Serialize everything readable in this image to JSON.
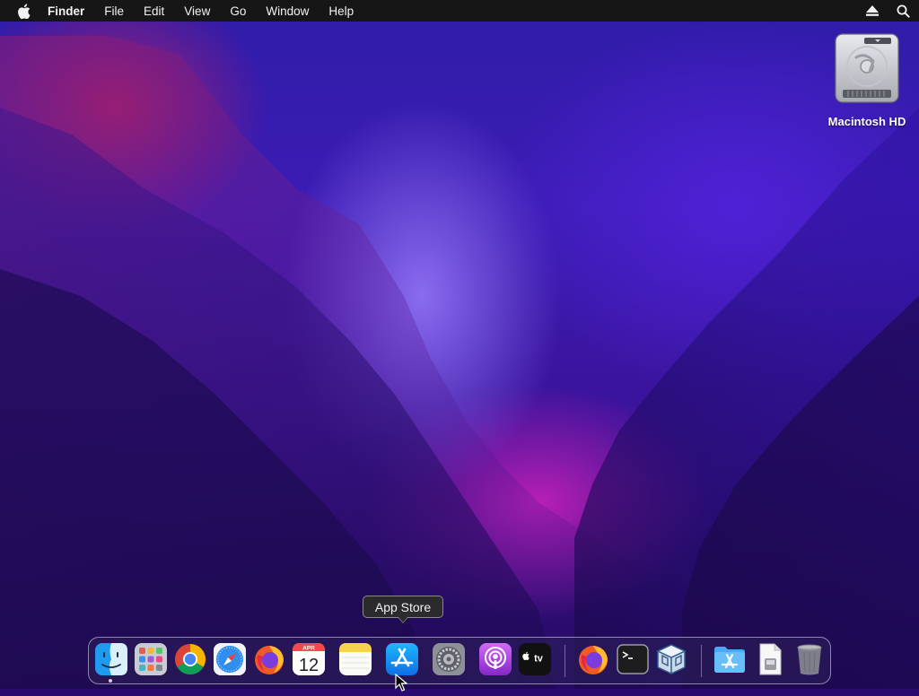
{
  "menubar": {
    "apple_menu": "apple-logo",
    "app_name": "Finder",
    "items": [
      "File",
      "Edit",
      "View",
      "Go",
      "Window",
      "Help"
    ],
    "status_icons": [
      "eject-icon",
      "spotlight-search-icon"
    ]
  },
  "desktop": {
    "icons": [
      {
        "label": "Macintosh HD",
        "icon": "hard-drive-icon"
      }
    ]
  },
  "tooltip": {
    "text": "App Store"
  },
  "dock": {
    "items": [
      {
        "name": "Finder",
        "icon": "finder-icon",
        "running": true
      },
      {
        "name": "Launchpad",
        "icon": "launchpad-icon"
      },
      {
        "name": "Google Chrome",
        "icon": "chrome-icon"
      },
      {
        "name": "Safari",
        "icon": "safari-icon"
      },
      {
        "name": "Firefox",
        "icon": "firefox-icon"
      },
      {
        "name": "Calendar",
        "icon": "calendar-icon",
        "month": "APR",
        "day": "12"
      },
      {
        "name": "Notes",
        "icon": "notes-icon"
      },
      {
        "name": "App Store",
        "icon": "app-store-icon",
        "hovered": true
      },
      {
        "name": "System Preferences",
        "icon": "system-preferences-icon"
      },
      {
        "name": "Podcasts",
        "icon": "podcasts-icon"
      },
      {
        "name": "Apple TV",
        "icon": "apple-tv-icon",
        "label": "tv"
      },
      {
        "name": "Firefox",
        "icon": "firefox-icon"
      },
      {
        "name": "Terminal",
        "icon": "terminal-icon"
      },
      {
        "name": "VirtualBox",
        "icon": "virtualbox-icon"
      },
      {
        "name": "Applications",
        "icon": "applications-folder-icon"
      },
      {
        "name": "Document",
        "icon": "document-icon"
      },
      {
        "name": "Trash",
        "icon": "trash-icon"
      }
    ]
  },
  "colors": {
    "menubar_bg": "#161616",
    "wallpaper_primary": "#3c1cb4",
    "wallpaper_accent": "#b81fb7",
    "tooltip_bg": "#2b2b2e"
  }
}
